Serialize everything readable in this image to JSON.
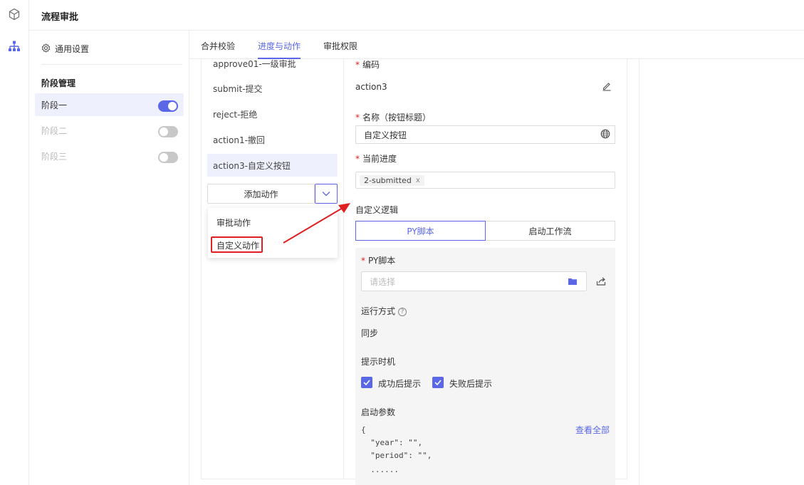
{
  "header": {
    "title": "流程审批"
  },
  "settings": {
    "general_label": "通用设置",
    "stage_title": "阶段管理",
    "stages": [
      {
        "label": "阶段一",
        "enabled": true
      },
      {
        "label": "阶段二",
        "enabled": false
      },
      {
        "label": "阶段三",
        "enabled": false
      }
    ]
  },
  "tabs": [
    {
      "label": "合并校验",
      "active": false
    },
    {
      "label": "进度与动作",
      "active": true
    },
    {
      "label": "审批权限",
      "active": false
    }
  ],
  "actions": [
    "approve01-一级审批",
    "submit-提交",
    "reject-拒绝",
    "action1-撤回",
    "action3-自定义按钮"
  ],
  "add_action": {
    "label": "添加动作",
    "menu": [
      "审批动作",
      "自定义动作"
    ]
  },
  "form": {
    "code_label": "编码",
    "code_value": "action3",
    "name_label": "名称（按钮标题）",
    "name_value": "自定义按钮",
    "progress_label": "当前进度",
    "progress_tag": "2-submitted",
    "progress_tag_close": "x",
    "logic_label": "自定义逻辑",
    "logic_options": [
      "PY脚本",
      "启动工作流"
    ],
    "py_label": "PY脚本",
    "py_placeholder": "请选择",
    "run_mode_label": "运行方式",
    "run_mode_value": "同步",
    "notify_label": "提示时机",
    "notify_success": "成功后提示",
    "notify_fail": "失败后提示",
    "params_label": "启动参数",
    "view_all": "查看全部",
    "params_code": [
      "{",
      "  \"year\": \"\",",
      "  \"period\": \"\",",
      "  ......"
    ]
  },
  "colors": {
    "accent": "#5a67e6",
    "highlight": "#e02020"
  }
}
